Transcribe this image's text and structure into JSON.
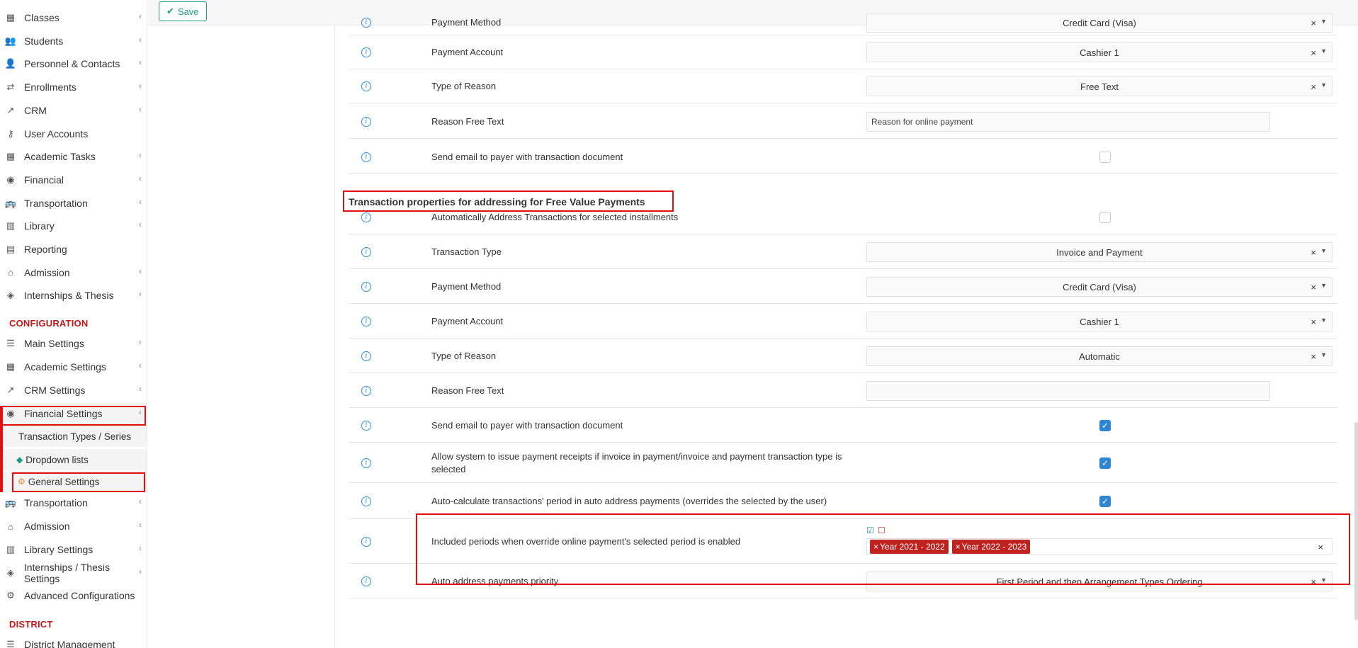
{
  "sidebar": {
    "items": [
      {
        "label": "Classes",
        "icon": "classes-icon",
        "glyph": "▦",
        "chevron": true
      },
      {
        "label": "Students",
        "icon": "students-icon",
        "glyph": "👥",
        "chevron": true
      },
      {
        "label": "Personnel & Contacts",
        "icon": "personnel-icon",
        "glyph": "👤",
        "chevron": true
      },
      {
        "label": "Enrollments",
        "icon": "enrollments-icon",
        "glyph": "⇄",
        "chevron": true
      },
      {
        "label": "CRM",
        "icon": "crm-icon",
        "glyph": "↗",
        "chevron": true
      },
      {
        "label": "User Accounts",
        "icon": "key-icon",
        "glyph": "⚷",
        "chevron": false
      },
      {
        "label": "Academic Tasks",
        "icon": "tasks-icon",
        "glyph": "▦",
        "chevron": true
      },
      {
        "label": "Financial",
        "icon": "coins-icon",
        "glyph": "◉",
        "chevron": true
      },
      {
        "label": "Transportation",
        "icon": "bus-icon",
        "glyph": "🚌",
        "chevron": true
      },
      {
        "label": "Library",
        "icon": "library-icon",
        "glyph": "▥",
        "chevron": true
      },
      {
        "label": "Reporting",
        "icon": "print-icon",
        "glyph": "▤",
        "chevron": false
      },
      {
        "label": "Admission",
        "icon": "institution-icon",
        "glyph": "⌂",
        "chevron": true
      },
      {
        "label": "Internships & Thesis",
        "icon": "cube-icon",
        "glyph": "◈",
        "chevron": true
      }
    ],
    "config_header": "CONFIGURATION",
    "config_items": [
      {
        "label": "Main Settings",
        "icon": "sliders-icon",
        "glyph": "☰",
        "chevron": true
      },
      {
        "label": "Academic Settings",
        "icon": "academic-icon",
        "glyph": "▦",
        "chevron": true
      },
      {
        "label": "CRM Settings",
        "icon": "crm-icon",
        "glyph": "↗",
        "chevron": true
      },
      {
        "label": "Financial Settings",
        "icon": "coins-icon",
        "glyph": "◉",
        "chevron": true
      }
    ],
    "financial_sub": [
      {
        "label": "Transaction Types / Series",
        "icon": "",
        "glyph": ""
      },
      {
        "label": "Dropdown lists",
        "icon": "layers-icon",
        "glyph": "◆"
      },
      {
        "label": "General Settings",
        "icon": "gear-icon",
        "glyph": "⚙"
      }
    ],
    "config_items_2": [
      {
        "label": "Transportation",
        "icon": "bus-icon",
        "glyph": "🚌",
        "chevron": true
      },
      {
        "label": "Admission",
        "icon": "institution-icon",
        "glyph": "⌂",
        "chevron": true
      },
      {
        "label": "Library Settings",
        "icon": "library-icon",
        "glyph": "▥",
        "chevron": true
      },
      {
        "label": "Internships / Thesis Settings",
        "icon": "cube-icon",
        "glyph": "◈",
        "chevron": true
      },
      {
        "label": "Advanced Configurations",
        "icon": "gears-icon",
        "glyph": "⚙",
        "chevron": false
      }
    ],
    "district_header": "DISTRICT",
    "district_items": [
      {
        "label": "District Management",
        "icon": "district-icon",
        "glyph": "☰"
      }
    ]
  },
  "toolbar": {
    "save_label": "Save",
    "save_glyph": "✔"
  },
  "rows_top": [
    {
      "label": "Payment Method",
      "type": "select",
      "value": "Credit Card (Visa)"
    },
    {
      "label": "Payment Account",
      "type": "select",
      "value": "Cashier 1"
    },
    {
      "label": "Type of Reason",
      "type": "select",
      "value": "Free Text"
    },
    {
      "label": "Reason Free Text",
      "type": "input",
      "value": "Reason for online payment"
    },
    {
      "label": "Send email to payer with transaction document",
      "type": "checkbox",
      "checked": false
    }
  ],
  "section_title": "Transaction properties for addressing for Free Value Payments",
  "rows_bottom": [
    {
      "label": "Automatically Address Transactions for selected installments",
      "type": "checkbox",
      "checked": false
    },
    {
      "label": "Transaction Type",
      "type": "select",
      "value": "Invoice and Payment"
    },
    {
      "label": "Payment Method",
      "type": "select",
      "value": "Credit Card (Visa)"
    },
    {
      "label": "Payment Account",
      "type": "select",
      "value": "Cashier 1"
    },
    {
      "label": "Type of Reason",
      "type": "select",
      "value": "Automatic"
    },
    {
      "label": "Reason Free Text",
      "type": "input",
      "value": ""
    },
    {
      "label": "Send email to payer with transaction document",
      "type": "checkbox",
      "checked": true
    },
    {
      "label": "Allow system to issue payment receipts if invoice in payment/invoice and payment transaction type is selected",
      "type": "checkbox",
      "checked": true
    },
    {
      "label": "Auto-calculate transactions' period in auto address payments (overrides the selected by the user)",
      "type": "checkbox",
      "checked": true
    },
    {
      "label": "Included periods when override online payment's selected period is enabled",
      "type": "tags",
      "tags": [
        "Year 2021 - 2022",
        "Year 2022 - 2023"
      ]
    },
    {
      "label": "Auto address payments priority",
      "type": "select",
      "value": "First Period and then Arrangement Types Ordering"
    }
  ],
  "glyphs": {
    "info": "i",
    "clear": "×",
    "caret": "▼",
    "check": "✓",
    "select_all": "☑",
    "deselect_all": "☐"
  }
}
